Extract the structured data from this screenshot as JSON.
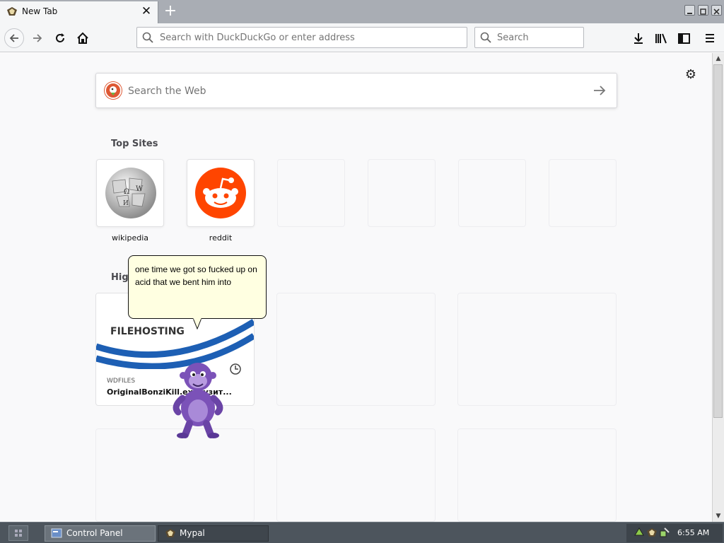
{
  "browser": {
    "tab": {
      "title": "New Tab",
      "close_glyph": "✕"
    },
    "new_tab_glyph": "+",
    "urlbar": {
      "placeholder": "Search with DuckDuckGo or enter address"
    },
    "searchbar": {
      "placeholder": "Search"
    }
  },
  "newtab": {
    "web_search": {
      "placeholder": "Search the Web"
    },
    "settings_glyph": "⚙",
    "top_sites": {
      "heading": "Top Sites",
      "sites": [
        {
          "label": "wikipedia",
          "icon": "wikipedia-globe-icon"
        },
        {
          "label": "reddit",
          "icon": "reddit-alien-icon"
        },
        {
          "label": "",
          "icon": ""
        },
        {
          "label": "",
          "icon": ""
        },
        {
          "label": "",
          "icon": ""
        },
        {
          "label": "",
          "icon": ""
        }
      ]
    },
    "highlights": {
      "heading_visible": "High",
      "cards": [
        {
          "thumbnail_text": "FILEHOSTING",
          "source": "WDFILES",
          "title": "OriginalBonziKill.ex… узит..."
        }
      ]
    }
  },
  "assistant": {
    "name": "Bonzi",
    "speech": "one time we got so fucked up on acid that we bent him into"
  },
  "taskbar": {
    "tasks": [
      {
        "label": "Control Panel"
      },
      {
        "label": "Mypal"
      }
    ],
    "clock": "6:55 AM"
  },
  "colors": {
    "reddit": "#ff4500",
    "duckduckgo": "#de5833",
    "bonzi_purple": "#7b52b8",
    "bubble": "#ffffe1"
  }
}
